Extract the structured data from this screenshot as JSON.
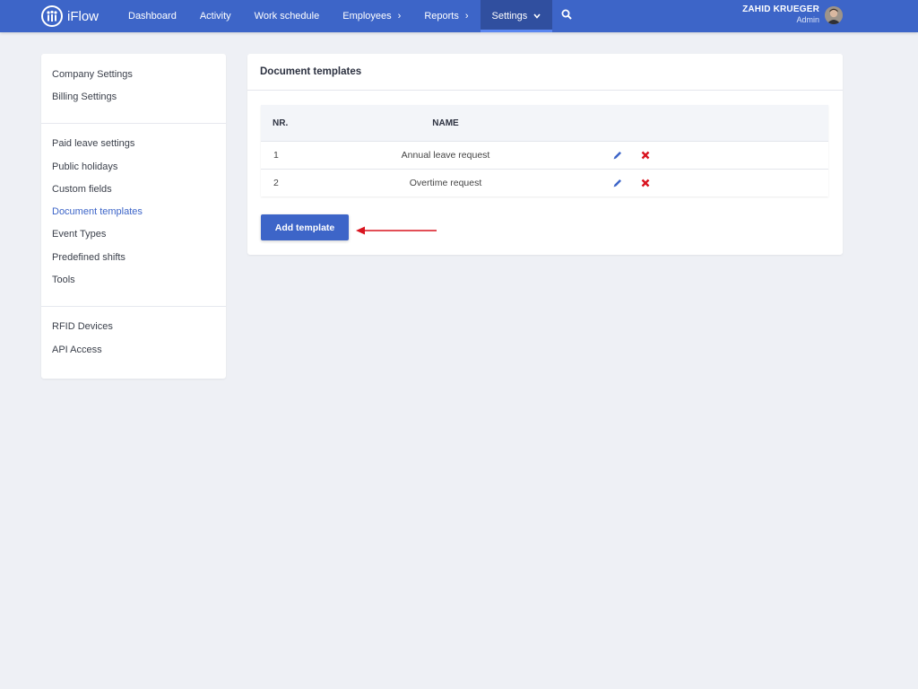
{
  "brand": {
    "name": "iFlow"
  },
  "nav": {
    "items": [
      {
        "label": "Dashboard",
        "chevron": false
      },
      {
        "label": "Activity",
        "chevron": false
      },
      {
        "label": "Work schedule",
        "chevron": false
      },
      {
        "label": "Employees",
        "chevron": true
      },
      {
        "label": "Reports",
        "chevron": true
      },
      {
        "label": "Settings",
        "chevron": true,
        "active": true
      }
    ],
    "search_icon": "search-icon"
  },
  "user": {
    "name": "ZAHID KRUEGER",
    "role": "Admin"
  },
  "sidebar": {
    "groups": [
      {
        "items": [
          {
            "label": "Company Settings"
          },
          {
            "label": "Billing Settings"
          }
        ]
      },
      {
        "items": [
          {
            "label": "Paid leave settings"
          },
          {
            "label": "Public holidays"
          },
          {
            "label": "Custom fields"
          },
          {
            "label": "Document templates",
            "active": true
          },
          {
            "label": "Event Types"
          },
          {
            "label": "Predefined shifts"
          },
          {
            "label": "Tools"
          }
        ]
      },
      {
        "items": [
          {
            "label": "RFID Devices"
          },
          {
            "label": "API Access"
          }
        ]
      }
    ]
  },
  "main": {
    "title": "Document templates",
    "table": {
      "headers": {
        "nr": "NR.",
        "name": "NAME"
      },
      "rows": [
        {
          "nr": "1",
          "name": "Annual leave request"
        },
        {
          "nr": "2",
          "name": "Overtime request"
        }
      ]
    },
    "add_button": "Add template"
  },
  "colors": {
    "primary": "#3d65c8",
    "delete": "#d9141f",
    "annotation_arrow": "#d9141f"
  }
}
